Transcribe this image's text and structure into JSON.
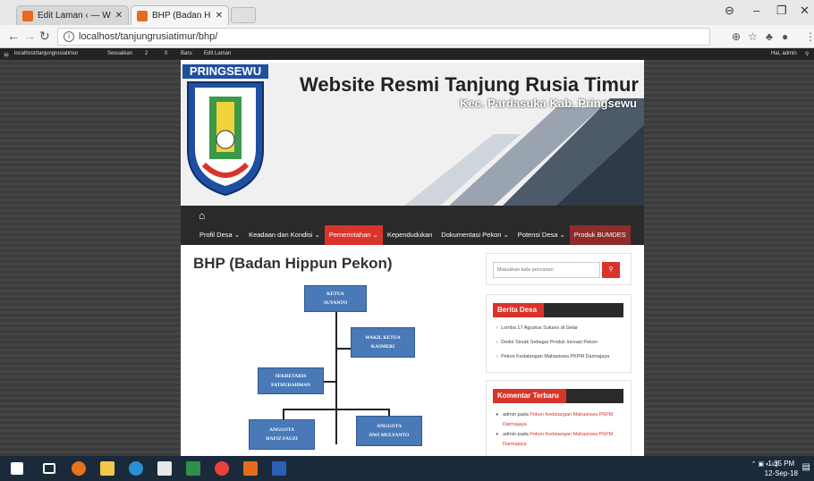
{
  "browser": {
    "tabs": [
      {
        "title": "Edit Laman ‹ — WordPre"
      },
      {
        "title": "BHP (Badan Hippun Peko"
      }
    ],
    "url": "localhost/tanjungrusiatimur/bhp/"
  },
  "wp_admin_bar": {
    "site": "localhost/tanjungrusiatimur",
    "customize": "Sesuaikan",
    "updates": "2",
    "comments": "0",
    "new": "Baru",
    "edit": "Edit Laman",
    "greeting": "Hai, admin"
  },
  "header": {
    "logo_label": "PRINGSEWU",
    "title": "Website Resmi Tanjung Rusia Timur",
    "subtitle": "Kec. Pardasuka Kab. Pringsewu"
  },
  "nav": {
    "items": [
      {
        "label": "Profil Desa ⌄"
      },
      {
        "label": "Keadaan dan Kondisi ⌄"
      },
      {
        "label": "Pemerintahan ⌄"
      },
      {
        "label": "Kependudukan"
      },
      {
        "label": "Dokumentasi Pekon ⌄"
      },
      {
        "label": "Potensi Desa ⌄"
      },
      {
        "label": "Produk BUMDES"
      }
    ]
  },
  "page": {
    "title": "BHP (Badan Hippun Pekon)"
  },
  "org_chart": {
    "ketua": {
      "role": "KETUA",
      "name": "SUYANTO"
    },
    "wakil": {
      "role": "WAKIL KETUA",
      "name": "KASMERI"
    },
    "sekretaris": {
      "role": "SEKRETARIS",
      "name": "FATHURAHMAN"
    },
    "anggota1": {
      "role": "ANGGOTA",
      "name": "HAFIZ FAUZI"
    },
    "anggota2": {
      "role": "ANGGOTA",
      "name": "DWI MULYANTO"
    }
  },
  "sidebar": {
    "search_placeholder": "Masukkan kata pencarian",
    "berita": {
      "title": "Berita Desa",
      "items": [
        "Lomba 17 Agustus Sukses di Gelar",
        "Dodol Sirsak Sebagai Produk Inovasi Pekon",
        "Pekon Kedatangan Mahasiswa PKPM Darmajaya"
      ]
    },
    "komentar": {
      "title": "Komentar Terbaru",
      "items": [
        {
          "author": "admin",
          "on": "pada",
          "link": "Pekon Kedatangan Mahasiswa PKPM Darmajaya"
        },
        {
          "author": "admin",
          "on": "pada",
          "link": "Pekon Kedatangan Mahasiswa PKPM Darmajaya"
        }
      ]
    }
  },
  "taskbar": {
    "time": "1:35 PM",
    "date": "12-Sep-18"
  },
  "colors": {
    "accent": "#d9342b",
    "nav_bg": "#2a2a2a",
    "org_box": "#4a79b7",
    "logo_blue": "#1e4fa0"
  }
}
